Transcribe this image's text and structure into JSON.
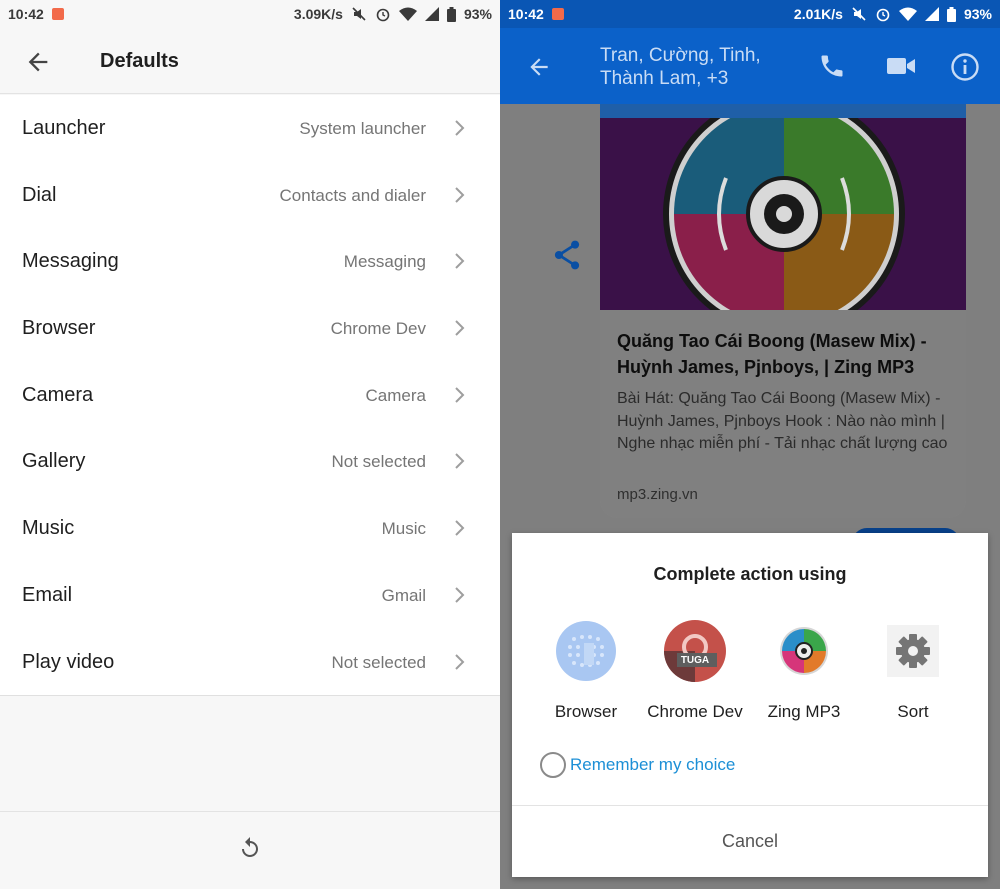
{
  "left": {
    "status": {
      "time": "10:42",
      "speed": "3.09K/s",
      "battery": "93%"
    },
    "header": {
      "title": "Defaults"
    },
    "items": [
      {
        "label": "Launcher",
        "value": "System launcher"
      },
      {
        "label": "Dial",
        "value": "Contacts and dialer"
      },
      {
        "label": "Messaging",
        "value": "Messaging"
      },
      {
        "label": "Browser",
        "value": "Chrome Dev"
      },
      {
        "label": "Camera",
        "value": "Camera"
      },
      {
        "label": "Gallery",
        "value": "Not selected"
      },
      {
        "label": "Music",
        "value": "Music"
      },
      {
        "label": "Email",
        "value": "Gmail"
      },
      {
        "label": "Play video",
        "value": "Not selected"
      }
    ]
  },
  "right": {
    "status": {
      "time": "10:42",
      "speed": "2.01K/s",
      "battery": "93%"
    },
    "appbar": {
      "title_line1": "Tran, Cường, Tinh,",
      "title_line2": "Thành Lam, +3"
    },
    "card": {
      "title": "Quăng Tao Cái Boong (Masew Mix) - Huỳnh James, Pjnboys, | Zing MP3",
      "description": "Bài Hát: Quăng Tao Cái Boong (Masew Mix) - Huỳnh James, Pjnboys Hook : Nào nào mình | Nghe nhạc miễn phí - Tải nhạc chất lượng cao",
      "domain": "mp3.zing.vn"
    },
    "dialog": {
      "title": "Complete action using",
      "apps": [
        {
          "label": "Browser",
          "icon": "browser-icon"
        },
        {
          "label": "Chrome Dev",
          "icon": "chrome-dev-icon",
          "badge": "TUGA"
        },
        {
          "label": "Zing MP3",
          "icon": "zing-mp3-icon"
        },
        {
          "label": "Sort",
          "icon": "gear-icon"
        }
      ],
      "remember": "Remember my choice",
      "cancel": "Cancel"
    }
  },
  "colors": {
    "appbar": "#0b61c9",
    "link": "#1c8fd6",
    "notif": "#f26a4a"
  }
}
